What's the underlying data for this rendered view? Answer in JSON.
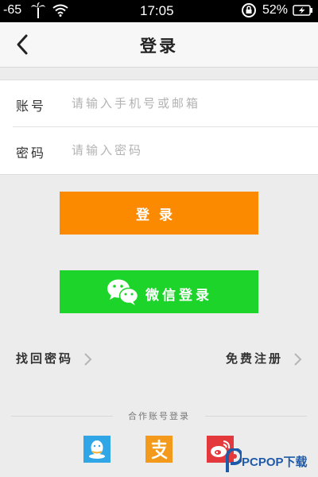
{
  "status_bar": {
    "signal": "-65",
    "time": "17:05",
    "battery_percent": "52%",
    "icons": [
      "palm-tree-icon",
      "wifi-icon",
      "rotation-lock-icon",
      "battery-icon"
    ]
  },
  "nav": {
    "title": "登录",
    "back_icon": "chevron-left-icon"
  },
  "form": {
    "account": {
      "label": "账号",
      "placeholder": "请输入手机号或邮箱",
      "value": ""
    },
    "password": {
      "label": "密码",
      "placeholder": "请输入密码",
      "value": ""
    }
  },
  "buttons": {
    "login_label": "登录",
    "wechat_label": "微信登录"
  },
  "links": {
    "forgot_password": "找回密码",
    "register": "免费注册"
  },
  "partner": {
    "label": "合作账号登录",
    "providers": [
      "qq-icon",
      "alipay-icon",
      "weibo-icon"
    ]
  },
  "watermark": {
    "text": "PCPOP下载"
  },
  "colors": {
    "login_button": "#fb8a00",
    "wechat_button": "#1dd42a",
    "qq": "#31a6e7",
    "alipay": "#f39a1c",
    "weibo": "#e4393c",
    "background": "#ececec"
  }
}
